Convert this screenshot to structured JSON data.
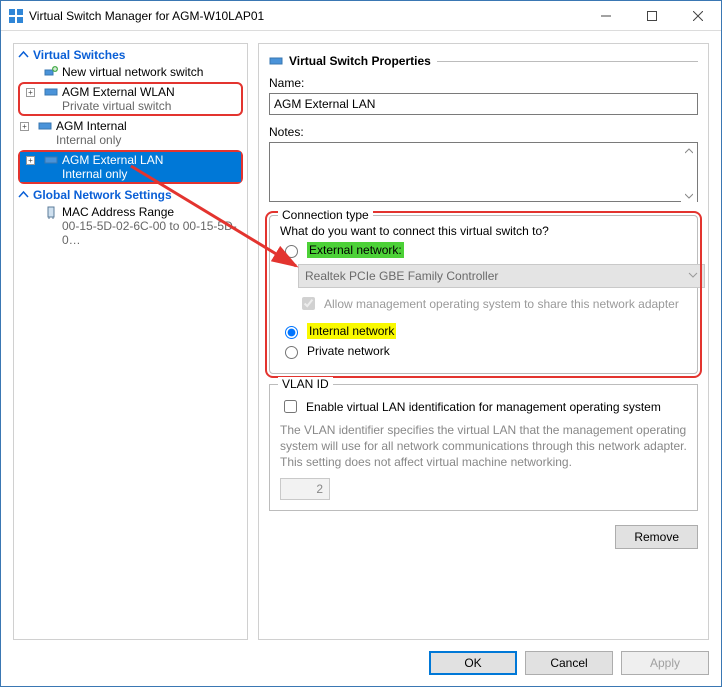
{
  "window": {
    "title": "Virtual Switch Manager for AGM-W10LAP01"
  },
  "tree": {
    "switches_header": "Virtual Switches",
    "new_switch": "New virtual network switch",
    "items": [
      {
        "label": "AGM External WLAN",
        "sub": "Private virtual switch"
      },
      {
        "label": "AGM Internal",
        "sub": "Internal only"
      },
      {
        "label": "AGM External LAN",
        "sub": "Internal only"
      }
    ],
    "global_header": "Global Network Settings",
    "mac_label": "MAC Address Range",
    "mac_value": "00-15-5D-02-6C-00 to 00-15-5D-0…"
  },
  "props": {
    "header": "Virtual Switch Properties",
    "name_label": "Name:",
    "name_value": "AGM External LAN",
    "notes_label": "Notes:"
  },
  "conn": {
    "group_title": "Connection type",
    "question": "What do you want to connect this virtual switch to?",
    "external": "External network:",
    "adapter": "Realtek PCIe GBE Family Controller",
    "allow_mgmt": "Allow management operating system to share this network adapter",
    "internal": "Internal network",
    "private": "Private network"
  },
  "vlan": {
    "group_title": "VLAN ID",
    "enable": "Enable virtual LAN identification for management operating system",
    "desc": "The VLAN identifier specifies the virtual LAN that the management operating system will use for all network communications through this network adapter. This setting does not affect virtual machine networking.",
    "value": "2"
  },
  "buttons": {
    "remove": "Remove",
    "ok": "OK",
    "cancel": "Cancel",
    "apply": "Apply"
  }
}
